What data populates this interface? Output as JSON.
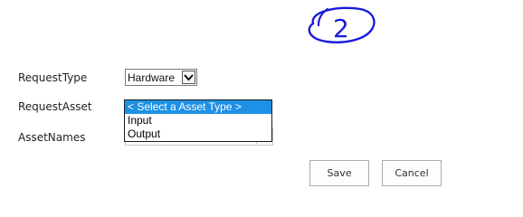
{
  "form": {
    "request_type_label": "RequestType",
    "request_asset_label": "RequestAsset",
    "asset_names_label": "AssetNames",
    "request_type_value": "Hardware",
    "request_asset_options": [
      {
        "label": "< Select a Asset Type >",
        "selected": true
      },
      {
        "label": "Input",
        "selected": false
      },
      {
        "label": "Output",
        "selected": false
      }
    ]
  },
  "buttons": {
    "save_label": "Save",
    "cancel_label": "Cancel"
  },
  "annotation": {
    "text": "2",
    "color": "#1a1adc"
  },
  "colors": {
    "selected_option_bg": "#1e90e6",
    "border": "#ababab"
  },
  "icons": {
    "dropdown_arrow": "chevron-down-icon"
  }
}
